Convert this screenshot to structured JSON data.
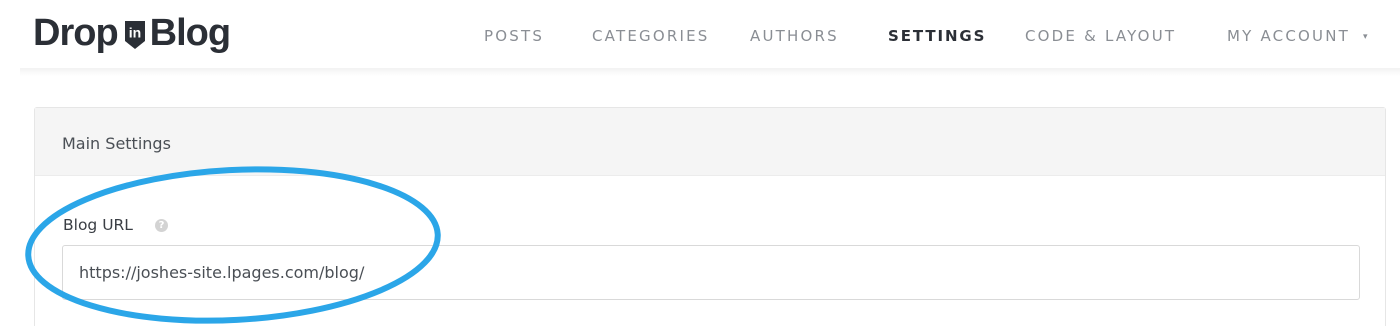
{
  "brand": {
    "name_left": "Drop",
    "badge_text": "in",
    "name_right": "Blog",
    "dark_color": "#2b2f36"
  },
  "nav": {
    "items": [
      {
        "label": "POSTS",
        "active": false
      },
      {
        "label": "CATEGORIES",
        "active": false
      },
      {
        "label": "AUTHORS",
        "active": false
      },
      {
        "label": "SETTINGS",
        "active": true
      },
      {
        "label": "CODE & LAYOUT",
        "active": false
      },
      {
        "label": "MY ACCOUNT",
        "active": false,
        "has_dropdown": true
      }
    ],
    "dropdown_icon": "caret-down-icon"
  },
  "settings_panel": {
    "title": "Main Settings",
    "blog_url": {
      "label": "Blog URL",
      "help_icon": "question-circle-icon",
      "value": "https://joshes-site.lpages.com/blog/"
    }
  },
  "annotation": {
    "shape": "ellipse",
    "color": "#2ba6e8"
  }
}
